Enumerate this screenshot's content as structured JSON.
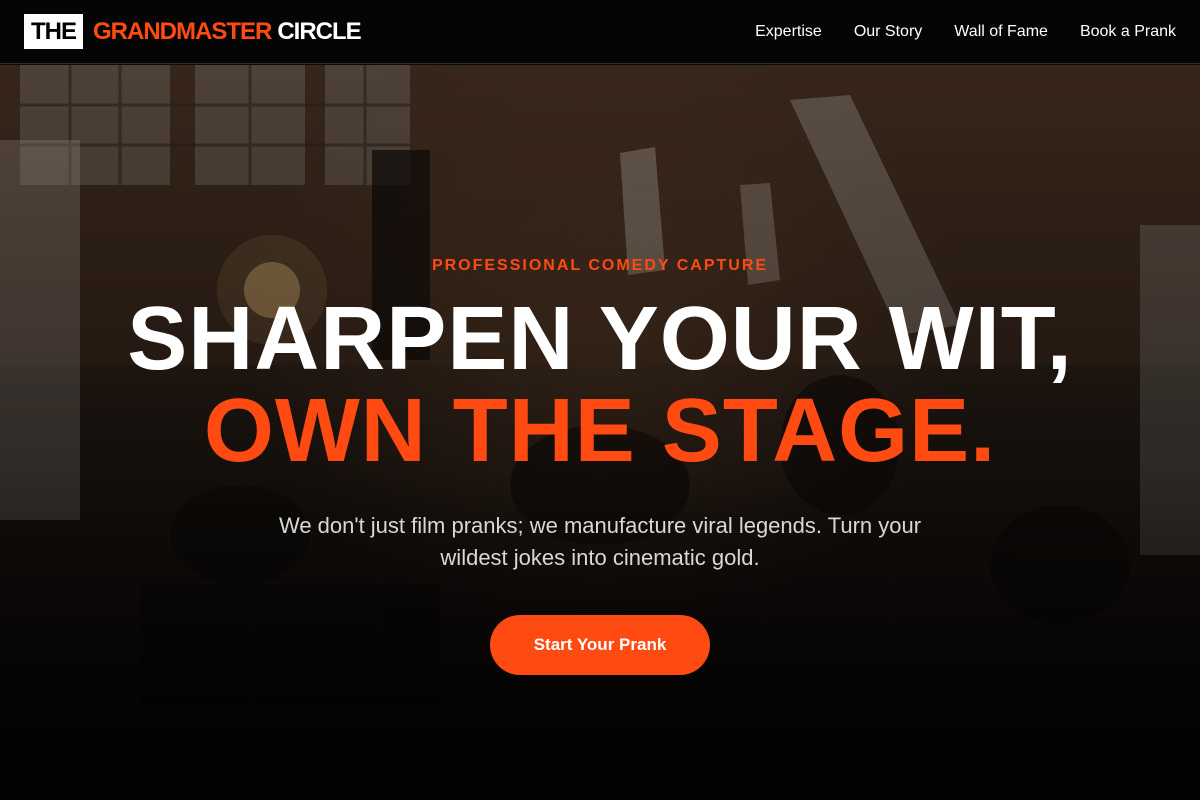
{
  "brand": {
    "the": "THE",
    "grandmaster": "GRANDMASTER",
    "circle": "CIRCLE"
  },
  "nav": {
    "items": [
      {
        "label": "Expertise"
      },
      {
        "label": "Our Story"
      },
      {
        "label": "Wall of Fame"
      },
      {
        "label": "Book a Prank"
      }
    ]
  },
  "hero": {
    "eyebrow": "PROFESSIONAL COMEDY CAPTURE",
    "headline_line1": "SHARPEN YOUR WIT,",
    "headline_line2": "OWN THE STAGE.",
    "subtext": "We don't just film pranks; we manufacture viral legends. Turn your wildest jokes into cinematic gold.",
    "cta_label": "Start Your Prank"
  },
  "colors": {
    "accent": "#ff4a12",
    "navbar_bg": "#050505",
    "text_primary": "#ffffff",
    "text_secondary": "#d8d8d8"
  }
}
